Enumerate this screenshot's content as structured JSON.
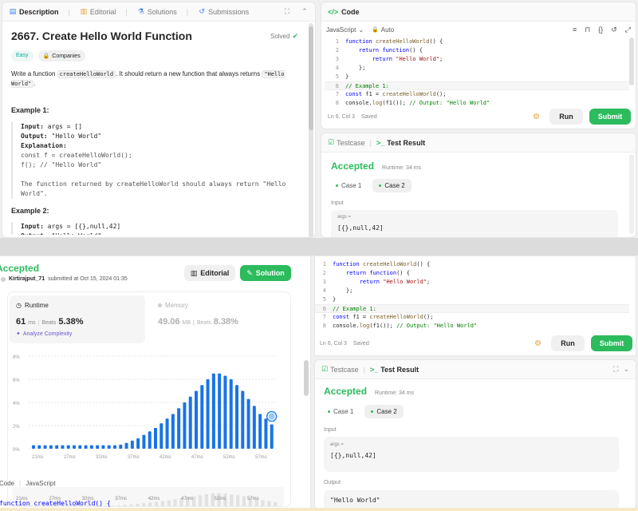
{
  "top_left": {
    "tabs": [
      {
        "label": "Description",
        "icon": "document-icon"
      },
      {
        "label": "Editorial",
        "icon": "book-icon"
      },
      {
        "label": "Solutions",
        "icon": "flask-icon"
      },
      {
        "label": "Submissions",
        "icon": "history-icon"
      }
    ],
    "problem_title": "2667. Create Hello World Function",
    "solved_label": "Solved",
    "difficulty": "Easy",
    "companies_label": "Companies",
    "desc_pre": "Write a function ",
    "desc_code1": "createHelloWorld",
    "desc_mid": ". It should return a new function that always returns ",
    "desc_code2": "\"Hello World\"",
    "desc_end": ".",
    "example1_heading": "Example 1:",
    "example1_lines": [
      {
        "k": "Input:",
        "v": " args = []"
      },
      {
        "k": "Output:",
        "v": " \"Hello World\""
      },
      {
        "k": "Explanation:",
        "v": ""
      },
      {
        "k": "",
        "v": "const f = createHelloWorld();"
      },
      {
        "k": "",
        "v": "f(); // \"Hello World\""
      },
      {
        "k": "",
        "v": ""
      },
      {
        "k": "",
        "v": "The function returned by createHelloWorld should always return \"Hello"
      },
      {
        "k": "",
        "v": "World\"."
      }
    ],
    "example2_heading": "Example 2:",
    "example2_lines": [
      {
        "k": "Input:",
        "v": " args = [{},null,42]"
      },
      {
        "k": "Output:",
        "v": " \"Hello World\""
      }
    ]
  },
  "code_panel": {
    "title": "Code",
    "language": "JavaScript",
    "mode": "Auto",
    "status": "Ln 6, Col 3",
    "saved": "Saved",
    "run_label": "Run",
    "submit_label": "Submit",
    "lines": [
      "function createHelloWorld() {",
      "    return function() {",
      "        return \"Hello World\";",
      "    };",
      "}",
      "// Example 1:",
      "const f1 = createHelloWorld();",
      "console.log(f1()); // Output: \"Hello World\""
    ],
    "line_numbers": [
      "1",
      "2",
      "3",
      "4",
      "5",
      "6",
      "7",
      "8"
    ]
  },
  "test_panel": {
    "testcase_tab": "Testcase",
    "result_tab": "Test Result",
    "verdict": "Accepted",
    "runtime": "Runtime: 34 ms",
    "case1": "Case 1",
    "case2": "Case 2",
    "input_label": "Input",
    "args_label": "args =",
    "args_value": "[{},null,42]",
    "output_label": "Output",
    "output_value": "\"Hello World\""
  },
  "submission": {
    "verdict": "Accepted",
    "user": "Kirtirajput_71",
    "submitted": "submitted at Oct 15, 2024 01:35",
    "editorial_label": "Editorial",
    "solution_label": "Solution",
    "runtime_label": "Runtime",
    "runtime_value": "61",
    "runtime_unit": "ms",
    "beats_label": "Beats",
    "runtime_beats": "5.38%",
    "analyze_label": "Analyze Complexity",
    "memory_label": "Memory",
    "memory_value": "49.06",
    "memory_unit": "MB",
    "memory_beats": "8.38%",
    "code_label": "Code",
    "code_lang": "JavaScript",
    "code_peek": "function createHelloWorld() {"
  },
  "chart_data": {
    "type": "bar",
    "y_ticks": [
      "8%",
      "6%",
      "4%",
      "2%",
      "0%"
    ],
    "ylim": [
      0,
      8
    ],
    "x_ticks": [
      "21ms",
      "27ms",
      "32ms",
      "37ms",
      "42ms",
      "47ms",
      "52ms",
      "57ms"
    ],
    "values": [
      0.3,
      0.3,
      0.3,
      0.3,
      0.3,
      0.3,
      0.3,
      0.3,
      0.3,
      0.3,
      0.3,
      0.3,
      0.3,
      0.3,
      0.3,
      0.35,
      0.5,
      0.7,
      0.9,
      1.2,
      1.5,
      1.8,
      2.2,
      2.6,
      3.0,
      3.5,
      4.0,
      4.5,
      5.0,
      5.5,
      6.0,
      6.5,
      6.5,
      6.3,
      6.0,
      5.5,
      5.0,
      4.3,
      3.7,
      3.0,
      2.6,
      2.1
    ],
    "highlight_index": 41,
    "highlight_color": "#2d8cf0",
    "bar_color": "#1a73e8"
  }
}
